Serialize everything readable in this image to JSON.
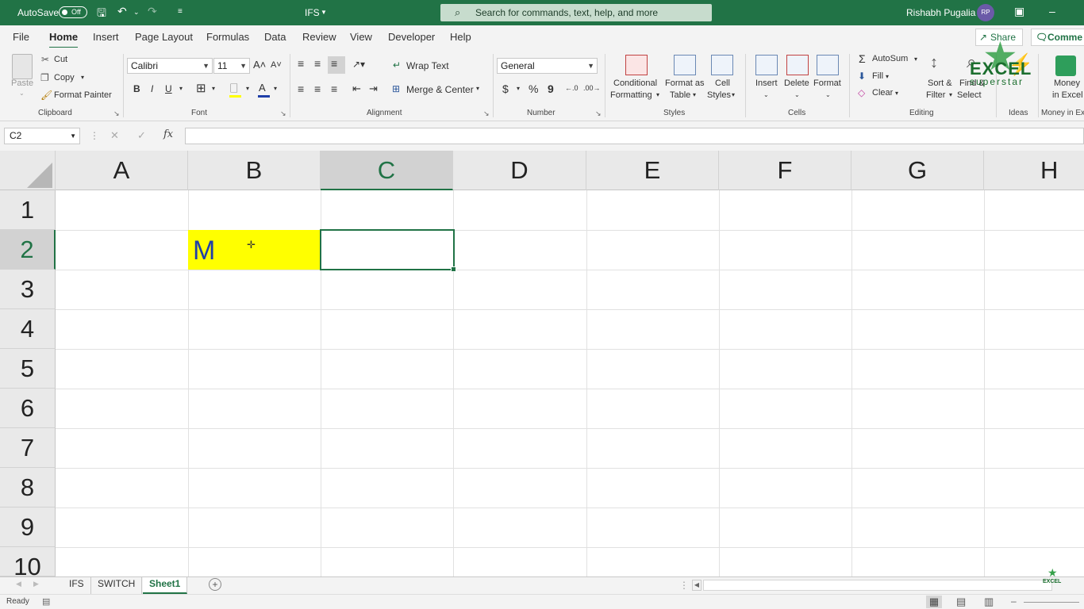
{
  "titlebar": {
    "autosave_label": "AutoSave",
    "autosave_state": "Off",
    "filename": "IFS",
    "search_placeholder": "Search for commands, text, help, and more",
    "user_name": "Rishabh Pugalia",
    "user_initials": "RP"
  },
  "menu": {
    "tabs": [
      "File",
      "Home",
      "Insert",
      "Page Layout",
      "Formulas",
      "Data",
      "Review",
      "View",
      "Developer",
      "Help"
    ],
    "active": "Home",
    "share": "Share",
    "comments": "Comme"
  },
  "ribbon": {
    "clipboard": {
      "paste": "Paste",
      "cut": "Cut",
      "copy": "Copy",
      "format_painter": "Format Painter",
      "group": "Clipboard"
    },
    "font": {
      "name": "Calibri",
      "size": "11",
      "bold": "B",
      "italic": "I",
      "underline": "U",
      "group": "Font"
    },
    "alignment": {
      "wrap_text": "Wrap Text",
      "merge_center": "Merge & Center",
      "group": "Alignment"
    },
    "number": {
      "format": "General",
      "currency": "$",
      "percent": "%",
      "comma": "9",
      "group": "Number"
    },
    "styles": {
      "conditional1": "Conditional",
      "conditional2": "Formatting",
      "format_table1": "Format as",
      "format_table2": "Table",
      "cell_styles1": "Cell",
      "cell_styles2": "Styles",
      "group": "Styles"
    },
    "cells": {
      "insert": "Insert",
      "delete": "Delete",
      "format": "Format",
      "group": "Cells"
    },
    "editing": {
      "autosum": "AutoSum",
      "fill": "Fill",
      "clear": "Clear",
      "sort1": "Sort &",
      "sort2": "Filter",
      "find1": "Find &",
      "find2": "Select",
      "group": "Editing"
    },
    "ideas": {
      "group": "Ideas"
    },
    "money": {
      "label1": "Money",
      "label2": "in Excel",
      "group": "Money in Ex"
    },
    "watermark": {
      "line1": "EXCEL",
      "line2": "superstar"
    }
  },
  "formula_bar": {
    "name_box": "C2",
    "cancel": "✕",
    "enter": "✓",
    "fx": "fx",
    "value": ""
  },
  "grid": {
    "columns": [
      "A",
      "B",
      "C",
      "D",
      "E",
      "F",
      "G",
      "H"
    ],
    "rows": [
      "1",
      "2",
      "3",
      "4",
      "5",
      "6",
      "7",
      "8",
      "9",
      "10"
    ],
    "selected_column": "C",
    "selected_row": "2",
    "cell_B2": "M"
  },
  "sheets": {
    "tabs": [
      "IFS",
      "SWITCH",
      "Sheet1"
    ],
    "active": "Sheet1",
    "add": "+"
  },
  "status": {
    "text": "Ready"
  },
  "colors": {
    "excel_green": "#217346",
    "highlight_yellow": "#ffff00",
    "cell_text_blue": "#1f3fa8"
  }
}
